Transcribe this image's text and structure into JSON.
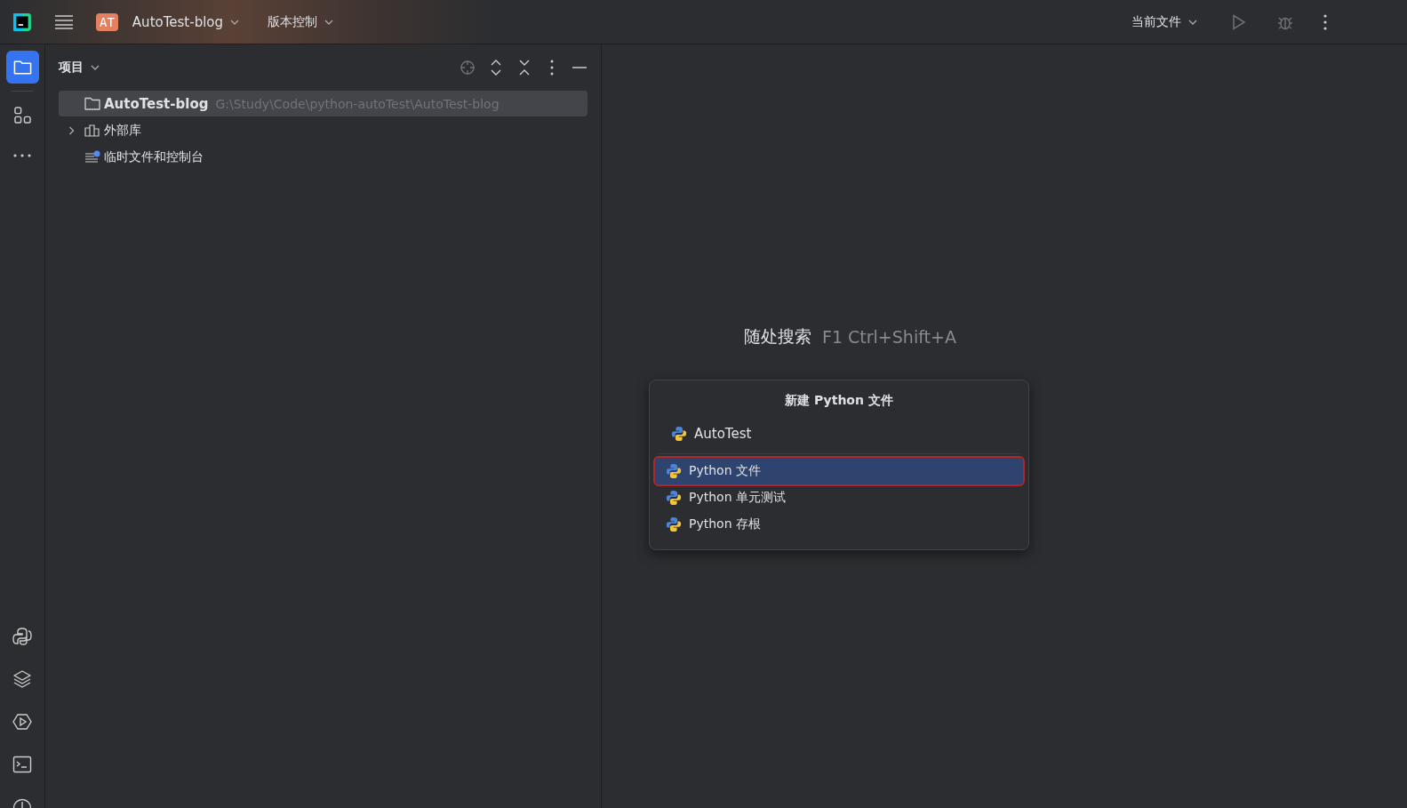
{
  "toolbar": {
    "project_badge": "AT",
    "project_name": "AutoTest-blog",
    "vcs": "版本控制",
    "run_config": "当前文件"
  },
  "side_tools": [
    {
      "kind": "folder",
      "selected": true
    },
    {
      "kind": "structure",
      "selected": false
    },
    {
      "kind": "more",
      "selected": false
    }
  ],
  "side_tools_bottom": [
    {
      "kind": "python"
    },
    {
      "kind": "layers"
    },
    {
      "kind": "services"
    },
    {
      "kind": "terminal"
    },
    {
      "kind": "problems"
    }
  ],
  "project_panel": {
    "title": "项目",
    "tree": [
      {
        "kind": "folder",
        "label": "AutoTest-blog",
        "path": "G:\\Study\\Code\\python-autoTest\\AutoTest-blog",
        "selected": true
      },
      {
        "kind": "library",
        "label": "外部库",
        "expanded": false,
        "selected": false
      },
      {
        "kind": "scratch",
        "label": "临时文件和控制台",
        "selected": false
      }
    ]
  },
  "hints": [
    {
      "label": "随处搜索",
      "shortcut": "F1 Ctrl+Shift+A"
    }
  ],
  "popup": {
    "title": "新建 Python 文件",
    "value": "AutoTest",
    "options": [
      {
        "label": "Python 文件",
        "selected": true
      },
      {
        "label": "Python 单元测试",
        "selected": false
      },
      {
        "label": "Python 存根",
        "selected": false
      }
    ]
  }
}
